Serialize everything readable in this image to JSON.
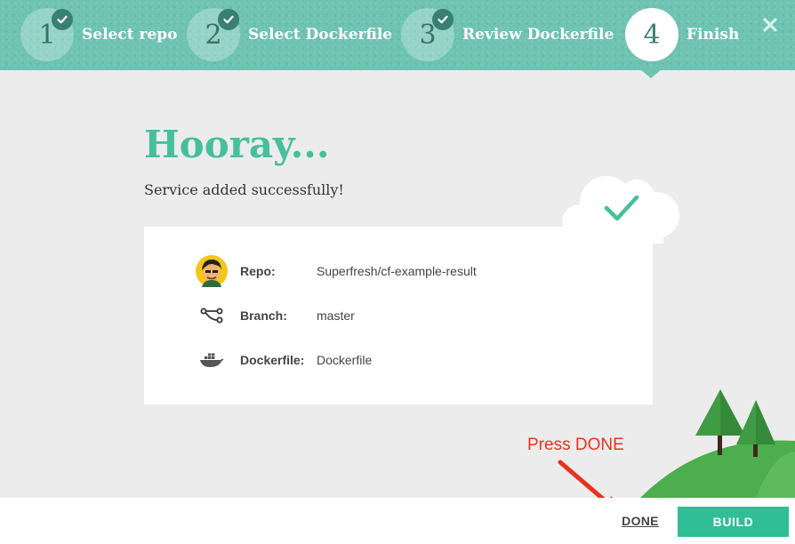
{
  "wizard": {
    "steps": [
      {
        "number": "1",
        "label": "Select repo",
        "completed": true
      },
      {
        "number": "2",
        "label": "Select Dockerfile",
        "completed": true
      },
      {
        "number": "3",
        "label": "Review Dockerfile",
        "completed": true
      },
      {
        "number": "4",
        "label": "Finish",
        "completed": false,
        "active": true
      }
    ],
    "close_icon": "close-icon"
  },
  "main": {
    "title": "Hooray...",
    "subtitle": "Service added successfully!",
    "summary": [
      {
        "icon": "avatar",
        "key": "Repo:",
        "value": "Superfresh/cf-example-result"
      },
      {
        "icon": "branch-icon",
        "key": "Branch:",
        "value": "master"
      },
      {
        "icon": "docker-icon",
        "key": "Dockerfile:",
        "value": "Dockerfile"
      }
    ]
  },
  "annotation": {
    "text": "Press DONE"
  },
  "footer": {
    "done_label": "DONE",
    "build_label": "BUILD"
  },
  "colors": {
    "header_bg": "#6ec3b3",
    "accent_green": "#45c09a",
    "build_button": "#2fbe96",
    "annotation_red": "#e8321f"
  }
}
